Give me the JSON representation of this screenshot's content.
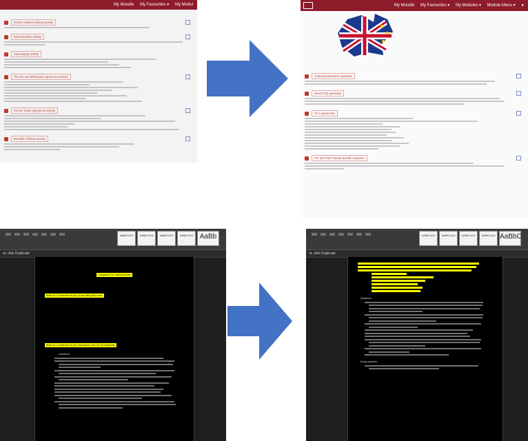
{
  "colors": {
    "moodle_nav": "#8e1b2a",
    "activity_accent": "#c0392b",
    "arrow_fill": "#4472c4",
    "word_background": "#1e1e1e",
    "word_highlight": "#ffff00"
  },
  "top_left": {
    "nav_items": [
      "My Moodle",
      "My Favourites ▾",
      "My Modul"
    ],
    "activities": [
      "UK/EU relations writing activity",
      "Brexit timeline activity",
      "Sovereignty activity",
      "The EU-UK Withdrawal Agreement activity",
      "EU-UK Trade Agreement activity",
      "Benefits of Brexit activity"
    ]
  },
  "top_right": {
    "nav_items": [
      "My Moodle",
      "My Favourites ▾",
      "My Modules ▾",
      "Module Menu ▾"
    ],
    "activities": [
      "Tutorial preparation questions",
      "Brexit FAQ questions",
      "TCA Agreement",
      "Pre and Post Tutorial specific response"
    ]
  },
  "bottom_left": {
    "style_gallery": [
      "AaBbCcDd",
      "AaBbCcDd",
      "AaBbCcDd",
      "AaBbCcDd",
      "AaBb"
    ],
    "status_text": "nt, click Duplicate",
    "heading": "Compulsory Pre-Tutorial activities",
    "subheading1": "Write out 1-2 sentences on why you are taking this course",
    "subheading2": "Write out 1-2 sentences on your impressions of the EU-UK relationship",
    "questions_label": "Questions:"
  },
  "bottom_right": {
    "style_gallery": [
      "AaBbCcDd",
      "AaBbCcDd",
      "AaBbCcDd",
      "AaBbCcDd",
      "AaBbC"
    ],
    "status_text": "nt, click Duplicate",
    "questions_label": "Questions:",
    "essay_label": "Essay question:"
  }
}
